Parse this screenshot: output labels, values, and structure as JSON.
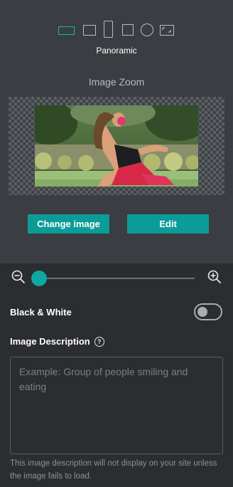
{
  "shape_selector": {
    "options": [
      "panoramic",
      "square",
      "portrait",
      "small-square",
      "circle",
      "landscape"
    ],
    "selected": "panoramic",
    "selected_label": "Panoramic"
  },
  "zoom_section": {
    "title": "Image Zoom",
    "zoom_level": 0.04
  },
  "buttons": {
    "change_image": "Change image",
    "edit": "Edit"
  },
  "black_white": {
    "label": "Black & White",
    "enabled": false
  },
  "description": {
    "label": "Image Description",
    "placeholder": "Example: Group of people smiling and eating",
    "value": "",
    "hint": "This image description will not display on your site unless the image fails to load."
  },
  "colors": {
    "accent": "#0c9c98",
    "panel": "#3a3d42",
    "background": "#2b2d30"
  }
}
